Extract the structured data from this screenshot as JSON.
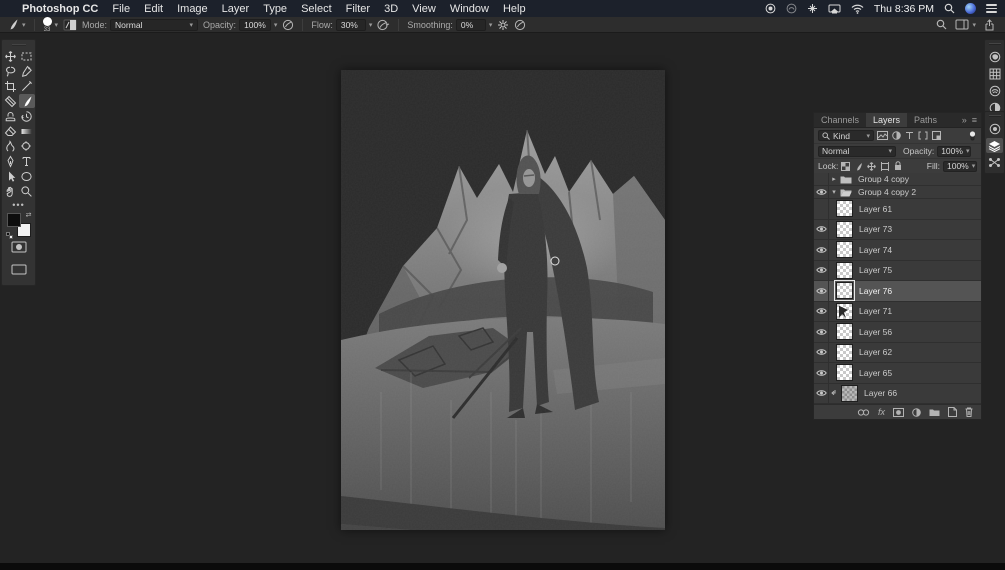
{
  "menubar": {
    "apple": "",
    "app_name": "Photoshop CC",
    "items": [
      "File",
      "Edit",
      "Image",
      "Layer",
      "Type",
      "Select",
      "Filter",
      "3D",
      "View",
      "Window",
      "Help"
    ],
    "time": "Thu 8:36 PM"
  },
  "options_bar": {
    "brush_size": "33",
    "mode_label": "Mode:",
    "mode_value": "Normal",
    "opacity_label": "Opacity:",
    "opacity_value": "100%",
    "flow_label": "Flow:",
    "flow_value": "30%",
    "smoothing_label": "Smoothing:",
    "smoothing_value": "0%"
  },
  "toolbar": {
    "tools": [
      "move",
      "marquee",
      "lasso",
      "quick-selection",
      "crop",
      "eyedropper",
      "spot-healing",
      "brush",
      "clone-stamp",
      "history-brush",
      "eraser",
      "gradient",
      "smudge",
      "dodge",
      "pen",
      "type",
      "path-selection",
      "ellipse",
      "hand",
      "zoom"
    ],
    "active_tool": "brush",
    "more_dots": "•••"
  },
  "layers_panel": {
    "tabs": [
      "Channels",
      "Layers",
      "Paths"
    ],
    "active_tab": "Layers",
    "collapse_glyph": "»",
    "menu_glyph": "≡",
    "filter_kind": "Kind",
    "blend_mode": "Normal",
    "opacity_label": "Opacity:",
    "opacity_value": "100%",
    "lock_label": "Lock:",
    "fill_label": "Fill:",
    "fill_value": "100%",
    "fx_label": "fx",
    "layers": [
      {
        "name": "Group 4 copy",
        "type": "group",
        "eye": false,
        "expanded": false
      },
      {
        "name": "Group 4 copy 2",
        "type": "group",
        "eye": true,
        "expanded": true
      },
      {
        "name": "Layer 61",
        "type": "layer",
        "eye": false
      },
      {
        "name": "Layer 73",
        "type": "layer",
        "eye": true
      },
      {
        "name": "Layer 74",
        "type": "layer",
        "eye": true
      },
      {
        "name": "Layer 75",
        "type": "layer",
        "eye": true
      },
      {
        "name": "Layer 76",
        "type": "layer",
        "eye": true,
        "selected": true
      },
      {
        "name": "Layer 71",
        "type": "layer",
        "eye": true,
        "mark": true
      },
      {
        "name": "Layer 56",
        "type": "layer",
        "eye": true
      },
      {
        "name": "Layer 62",
        "type": "layer",
        "eye": true
      },
      {
        "name": "Layer 65",
        "type": "layer",
        "eye": true
      },
      {
        "name": "Layer 66",
        "type": "layer",
        "eye": true,
        "clipped": true,
        "textured": true
      }
    ]
  },
  "colors": {
    "menubar_bg": "#1c212b",
    "panel_bg": "#3a3a3a",
    "selected_row": "#545454",
    "app_bg": "#232323",
    "canvas_grays": [
      "#9c9c9c",
      "#6a6a6a",
      "#454545",
      "#373737"
    ]
  }
}
